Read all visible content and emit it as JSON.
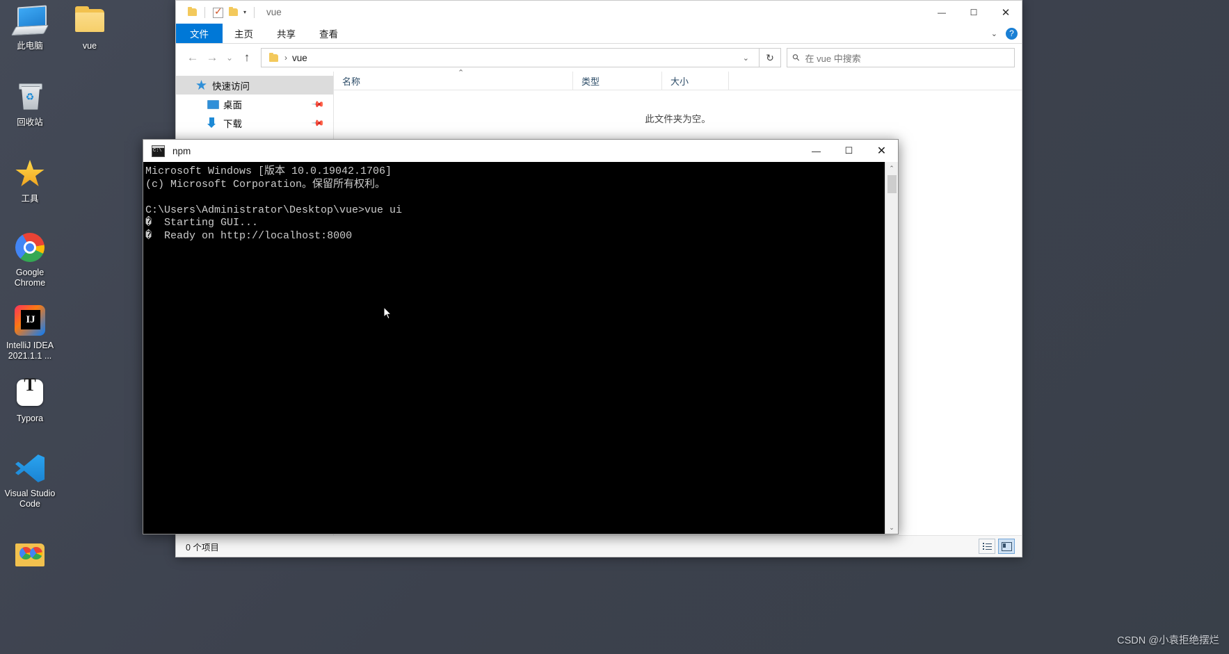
{
  "desktop": {
    "icons": [
      {
        "id": "this-pc",
        "label": "此电脑",
        "icon": "computer-icon"
      },
      {
        "id": "recycle-bin",
        "label": "回收站",
        "icon": "recycle-bin-icon"
      },
      {
        "id": "tools",
        "label": "工具",
        "icon": "star-folder-icon"
      },
      {
        "id": "google-chrome",
        "label": "Google Chrome",
        "icon": "chrome-icon"
      },
      {
        "id": "intellij-idea",
        "label": "IntelliJ IDEA 2021.1.1 ...",
        "icon": "intellij-idea-icon"
      },
      {
        "id": "typora",
        "label": "Typora",
        "icon": "typora-icon"
      },
      {
        "id": "vscode",
        "label": "Visual Studio Code",
        "icon": "vscode-icon"
      },
      {
        "id": "browser-folder",
        "label": "",
        "icon": "browser-folder-icon"
      }
    ],
    "vue_folder": {
      "label": "vue",
      "icon": "folder-icon"
    },
    "watermark": "CSDN @小袁拒绝摆烂",
    "background_color": "#3f4450"
  },
  "explorer": {
    "title": "vue",
    "quick_access_toolbar": {
      "folder_icon": "folder-icon",
      "properties_icon": "properties-checkbox-icon",
      "new_folder_icon": "new-folder-icon",
      "customize_caret": "▾"
    },
    "window_controls": {
      "minimize": "—",
      "maximize": "☐",
      "close": "✕"
    },
    "ribbon_tabs": [
      {
        "id": "file",
        "label": "文件",
        "selected": true
      },
      {
        "id": "home",
        "label": "主页",
        "selected": false
      },
      {
        "id": "share",
        "label": "共享",
        "selected": false
      },
      {
        "id": "view",
        "label": "查看",
        "selected": false
      }
    ],
    "ribbon_right": {
      "collapse_caret": "⌄",
      "help": "?"
    },
    "address_bar": {
      "back": "←",
      "forward": "→",
      "recent": "⌄",
      "up": "↑",
      "breadcrumb_icon": "folder-icon",
      "breadcrumb_sep": "›",
      "breadcrumb_text": "vue",
      "dropdown_caret": "⌄",
      "refresh": "↻"
    },
    "search": {
      "placeholder": "在 vue 中搜索",
      "icon": "search-icon"
    },
    "nav_pane": [
      {
        "id": "quick-access",
        "label": "快速访问",
        "icon": "star-icon",
        "selected": true,
        "pinned": false,
        "indent": false
      },
      {
        "id": "desktop",
        "label": "桌面",
        "icon": "desktop-icon",
        "selected": false,
        "pinned": true,
        "indent": true
      },
      {
        "id": "downloads",
        "label": "下载",
        "icon": "download-icon",
        "selected": false,
        "pinned": true,
        "indent": true
      }
    ],
    "columns": [
      {
        "id": "name",
        "label": "名称",
        "sorted": true,
        "sort_arrow": "⌃"
      },
      {
        "id": "type",
        "label": "类型",
        "sorted": false
      },
      {
        "id": "size",
        "label": "大小",
        "sorted": false
      }
    ],
    "empty_message": "此文件夹为空。",
    "status": {
      "item_count": "0 个项目"
    },
    "view_buttons": [
      {
        "id": "details-view",
        "icon": "details-view-icon",
        "active": false
      },
      {
        "id": "large-icons-view",
        "icon": "large-icons-view-icon",
        "active": true
      }
    ]
  },
  "cmd": {
    "title": "npm",
    "icon": "console-icon",
    "window_controls": {
      "minimize": "—",
      "maximize": "☐",
      "close": "✕"
    },
    "lines": [
      "Microsoft Windows [版本 10.0.19042.1706]",
      "(c) Microsoft Corporation。保留所有权利。",
      "",
      "C:\\Users\\Administrator\\Desktop\\vue>vue ui",
      "�  Starting GUI...",
      "�  Ready on http://localhost:8000"
    ],
    "scrollbar": {
      "up_arrow": "⌃",
      "down_arrow": "⌄"
    }
  }
}
